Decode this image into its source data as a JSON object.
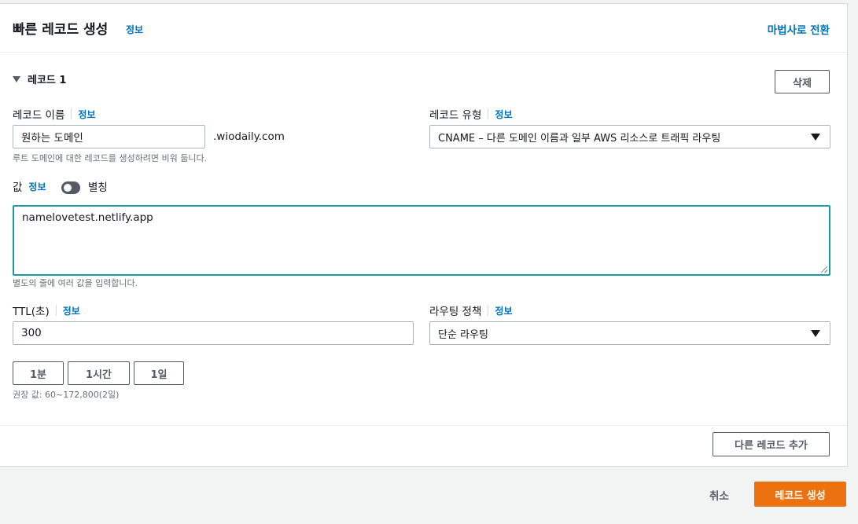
{
  "header": {
    "title": "빠른 레코드 생성",
    "info": "정보",
    "wizard_link": "마법사로 전환"
  },
  "record": {
    "section_label": "레코드 1",
    "delete_button": "삭제",
    "name": {
      "label": "레코드 이름",
      "info": "정보",
      "value": "원하는 도메인",
      "suffix": ".wiodaily.com",
      "hint": "루트 도메인에 대한 레코드를 생성하려면 비워 둡니다."
    },
    "type": {
      "label": "레코드 유형",
      "info": "정보",
      "selected": "CNAME – 다른 도메인 이름과 일부 AWS 리소스로 트래픽 라우팅"
    },
    "value": {
      "label": "값",
      "info": "정보",
      "alias_label": "별칭",
      "alias_enabled": false,
      "content": "namelovetest.netlify.app",
      "hint": "별도의 줄에 여러 값을 입력합니다."
    },
    "ttl": {
      "label": "TTL(초)",
      "info": "정보",
      "value": "300",
      "presets": [
        "1분",
        "1시간",
        "1일"
      ],
      "hint": "권장 값: 60~172,800(2일)"
    },
    "routing": {
      "label": "라우팅 정책",
      "info": "정보",
      "selected": "단순 라우팅"
    }
  },
  "add_record_button": "다른 레코드 추가",
  "footer": {
    "cancel": "취소",
    "create": "레코드 생성"
  },
  "colors": {
    "link": "#0073bb",
    "primary": "#ec7211",
    "focus": "#1a9c9c"
  }
}
